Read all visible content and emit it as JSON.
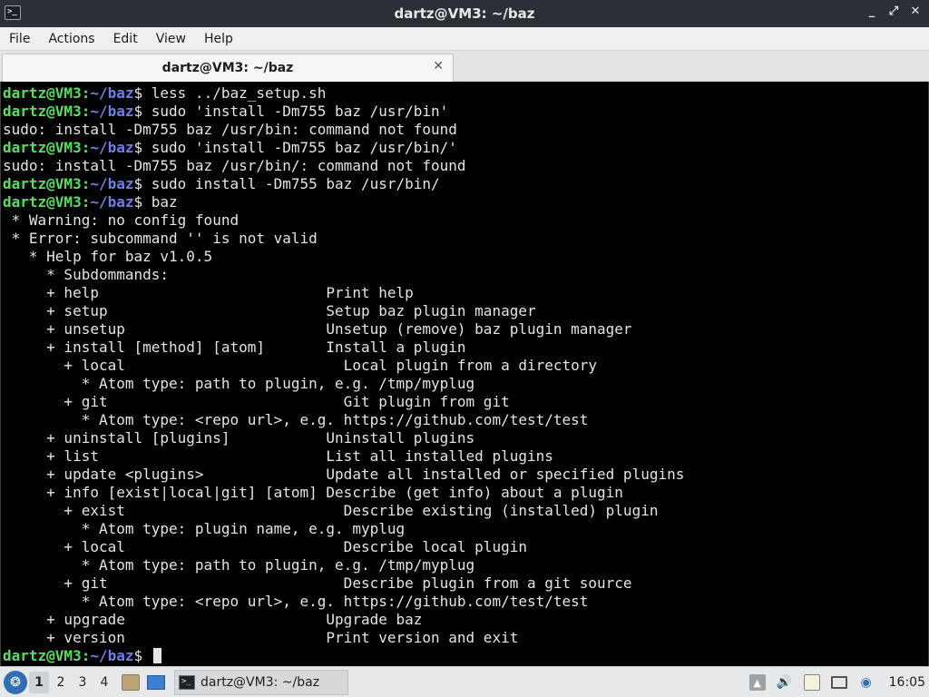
{
  "window": {
    "title": "dartz@VM3: ~/baz",
    "icon": "terminal-icon",
    "controls": {
      "minimize": "_",
      "maximize": "⤢",
      "close": "✕"
    }
  },
  "menu": {
    "items": [
      "File",
      "Actions",
      "Edit",
      "View",
      "Help"
    ]
  },
  "tabs": [
    {
      "label": "dartz@VM3: ~/baz",
      "close": "✕"
    }
  ],
  "terminal": {
    "prompt_user": "dartz@VM3",
    "prompt_sep": ":",
    "prompt_path": "~/baz",
    "prompt_symbol": "$ ",
    "colors": {
      "user": "#54e05c",
      "path": "#6d7fe8",
      "text": "#e4e4e4",
      "background": "#000000"
    },
    "lines": [
      {
        "type": "prompt",
        "text": "less ../baz_setup.sh"
      },
      {
        "type": "prompt",
        "text": "sudo 'install -Dm755 baz /usr/bin'"
      },
      {
        "type": "output",
        "text": "sudo: install -Dm755 baz /usr/bin: command not found"
      },
      {
        "type": "prompt",
        "text": "sudo 'install -Dm755 baz /usr/bin/'"
      },
      {
        "type": "output",
        "text": "sudo: install -Dm755 baz /usr/bin/: command not found"
      },
      {
        "type": "prompt",
        "text": "sudo install -Dm755 baz /usr/bin/"
      },
      {
        "type": "prompt",
        "text": "baz"
      },
      {
        "type": "output",
        "text": " * Warning: no config found"
      },
      {
        "type": "output",
        "text": " * Error: subcommand '' is not valid"
      },
      {
        "type": "output",
        "text": "   * Help for baz v1.0.5"
      },
      {
        "type": "output",
        "text": "     * Subdommands:"
      },
      {
        "type": "output",
        "text": "     + help                          Print help"
      },
      {
        "type": "output",
        "text": "     + setup                         Setup baz plugin manager"
      },
      {
        "type": "output",
        "text": "     + unsetup                       Unsetup (remove) baz plugin manager"
      },
      {
        "type": "output",
        "text": "     + install [method] [atom]       Install a plugin"
      },
      {
        "type": "output",
        "text": "       + local                         Local plugin from a directory"
      },
      {
        "type": "output",
        "text": "         * Atom type: path to plugin, e.g. /tmp/myplug"
      },
      {
        "type": "output",
        "text": "       + git                           Git plugin from git"
      },
      {
        "type": "output",
        "text": "         * Atom type: <repo url>, e.g. https://github.com/test/test"
      },
      {
        "type": "output",
        "text": "     + uninstall [plugins]           Uninstall plugins"
      },
      {
        "type": "output",
        "text": "     + list                          List all installed plugins"
      },
      {
        "type": "output",
        "text": "     + update <plugins>              Update all installed or specified plugins"
      },
      {
        "type": "output",
        "text": "     + info [exist|local|git] [atom] Describe (get info) about a plugin"
      },
      {
        "type": "output",
        "text": "       + exist                         Describe existing (installed) plugin"
      },
      {
        "type": "output",
        "text": "         * Atom type: plugin name, e.g. myplug"
      },
      {
        "type": "output",
        "text": "       + local                         Describe local plugin"
      },
      {
        "type": "output",
        "text": "         * Atom type: path to plugin, e.g. /tmp/myplug"
      },
      {
        "type": "output",
        "text": "       + git                           Describe plugin from a git source"
      },
      {
        "type": "output",
        "text": "         * Atom type: <repo url>, e.g. https://github.com/test/test"
      },
      {
        "type": "output",
        "text": "     + upgrade                       Upgrade baz"
      },
      {
        "type": "output",
        "text": "     + version                       Print version and exit"
      },
      {
        "type": "prompt_cursor",
        "text": ""
      }
    ]
  },
  "taskbar": {
    "start_icon": "lxqt-start-icon",
    "desktops": [
      "1",
      "2",
      "3",
      "4"
    ],
    "active_desktop": "1",
    "launchers": [
      "file-manager-icon",
      "show-desktop-icon"
    ],
    "task": {
      "label": "dartz@VM3: ~/baz",
      "icon": "terminal-icon"
    },
    "tray_icons": [
      "upload-icon",
      "volume-icon",
      "clipboard-icon",
      "screen-icon",
      "network-icon"
    ],
    "clock": "16:05"
  }
}
